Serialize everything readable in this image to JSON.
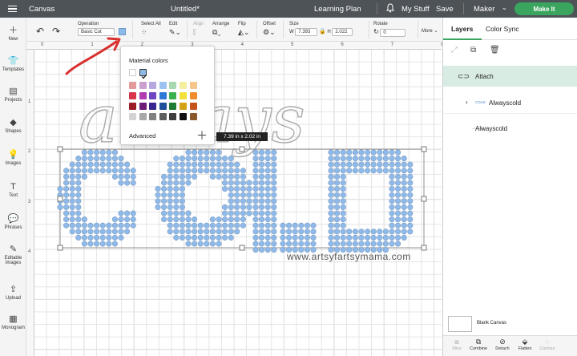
{
  "topbar": {
    "app_name": "Canvas",
    "doc_title": "Untitled*",
    "learning_plan": "Learning Plan",
    "my_stuff": "My Stuff",
    "save": "Save",
    "machine": "Maker",
    "make_it": "Make It"
  },
  "leftnav": [
    {
      "label": "New",
      "icon": "plus-icon"
    },
    {
      "label": "Templates",
      "icon": "shirt-icon"
    },
    {
      "label": "Projects",
      "icon": "projects-icon"
    },
    {
      "label": "Shapes",
      "icon": "shapes-icon"
    },
    {
      "label": "Images",
      "icon": "lightbulb-icon"
    },
    {
      "label": "Text",
      "icon": "text-icon"
    },
    {
      "label": "Phrases",
      "icon": "speech-bubble-icon"
    },
    {
      "label": "Editable Images",
      "icon": "editable-image-icon"
    },
    {
      "label": "Upload",
      "icon": "upload-icon"
    },
    {
      "label": "Monogram",
      "icon": "monogram-icon"
    }
  ],
  "toolbar": {
    "operation_label": "Operation",
    "operation_value": "Basic Cut",
    "select_all": "Select All",
    "edit": "Edit",
    "align": "Align",
    "arrange": "Arrange",
    "flip": "Flip",
    "offset": "Offset",
    "size": "Size",
    "w_label": "W",
    "w_value": "7.393",
    "h_label": "H",
    "h_value": "2.022",
    "rotate": "Rotate",
    "rotate_value": "0",
    "more": "More"
  },
  "ruler": {
    "top": [
      "0",
      "1",
      "2",
      "3",
      "4",
      "5",
      "6",
      "7",
      "8"
    ],
    "left": [
      "1",
      "2",
      "3",
      "4"
    ]
  },
  "color_popup": {
    "title": "Material colors",
    "advanced": "Advanced",
    "selected_color": "#8eb9e9",
    "rows": [
      [
        "#ffffff",
        "#8eb9e9"
      ],
      [
        "#e39a9a",
        "#c9a0d0",
        "#b8a8e0",
        "#9cc2f0",
        "#a8d8b0",
        "#f4ef9c",
        "#f5c58a"
      ],
      [
        "#d8344a",
        "#b13bb0",
        "#6e45c2",
        "#2f78d8",
        "#3bb04f",
        "#f1e13a",
        "#f08d2a"
      ],
      [
        "#9a1c24",
        "#6d1d78",
        "#3a2490",
        "#1d4f9a",
        "#1f7a33",
        "#d4a216",
        "#c4541b"
      ],
      [
        "#d3d3d3",
        "#a8a8a8",
        "#808080",
        "#5d5d5d",
        "#3e3e3e",
        "#111111",
        "#8a5a2b"
      ]
    ]
  },
  "canvas": {
    "dimension_label": "7.39  in x 2.02  in",
    "script_text": "always",
    "dot_text": "COLD",
    "watermark": "www.artsyfartsymama.com",
    "dot_color": "#8eb9e9"
  },
  "rightpanel": {
    "tab_layers": "Layers",
    "tab_color_sync": "Color Sync",
    "attach_label": "Attach",
    "layers": [
      {
        "name": "Alwayscold",
        "thumb": "COLD"
      },
      {
        "name": "Alwayscold",
        "thumb": ""
      }
    ],
    "blank_canvas": "Blank Canvas",
    "bottom": [
      "Slice",
      "Combine",
      "Detach",
      "Flatten",
      "Contour"
    ]
  }
}
